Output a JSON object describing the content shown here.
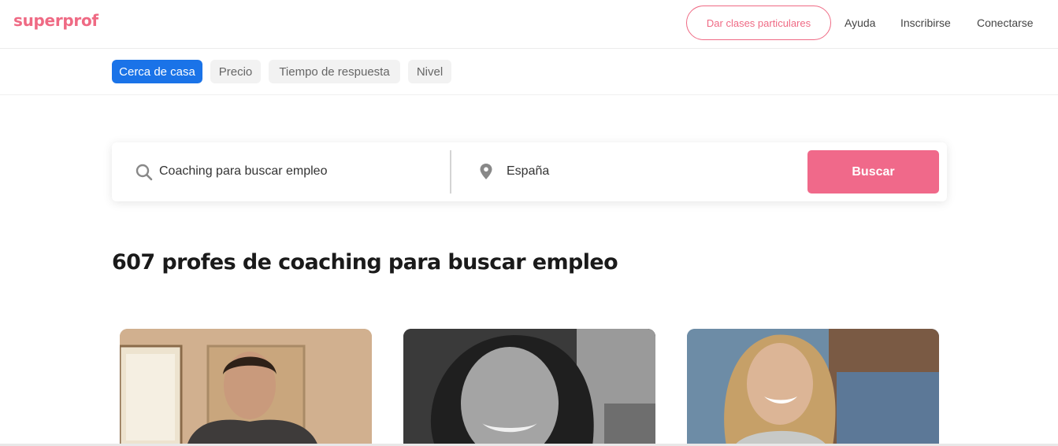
{
  "header": {
    "logo": "superprof",
    "give_classes_label": "Dar clases particulares",
    "help_label": "Ayuda",
    "signup_label": "Inscribirse",
    "login_label": "Conectarse"
  },
  "filters": [
    {
      "label": "Cerca de casa",
      "active": true
    },
    {
      "label": "Precio",
      "active": false
    },
    {
      "label": "Tiempo de respuesta",
      "active": false
    },
    {
      "label": "Nivel",
      "active": false
    }
  ],
  "search": {
    "query": "Coaching para buscar empleo",
    "location": "España",
    "button_label": "Buscar",
    "search_icon": "search-icon",
    "location_icon": "location-pin-icon"
  },
  "results": {
    "title": "607 profes de coaching para buscar empleo"
  },
  "colors": {
    "brand": "#ef6a84",
    "search_button": "#f0698a",
    "active_filter": "#1a73e8"
  }
}
